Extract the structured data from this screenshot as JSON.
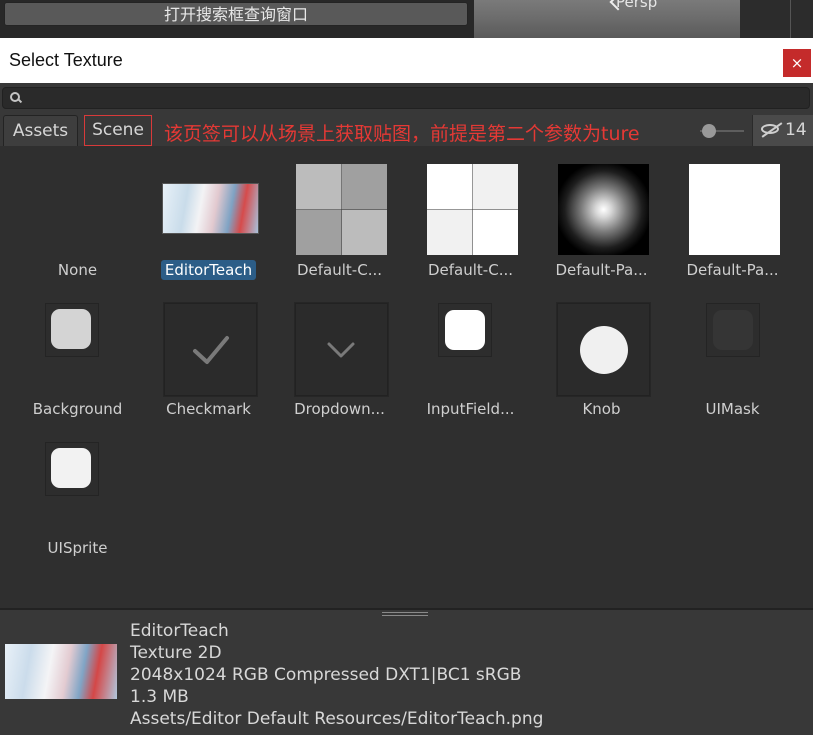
{
  "top": {
    "button_label": "打开搜索框查询窗口",
    "persp_label": "Persp"
  },
  "window": {
    "title": "Select Texture",
    "close_glyph": "×"
  },
  "search": {
    "value": "",
    "placeholder": ""
  },
  "tabs": {
    "assets": "Assets",
    "scene": "Scene",
    "annotation": "该页签可以从场景上获取贴图，前提是第二个参数为ture",
    "hidden_count": "14"
  },
  "items": [
    {
      "label": "None",
      "selected": false
    },
    {
      "label": "EditorTeach",
      "selected": true
    },
    {
      "label": "Default-C...",
      "selected": false
    },
    {
      "label": "Default-C...",
      "selected": false
    },
    {
      "label": "Default-Pa...",
      "selected": false
    },
    {
      "label": "Default-Pa...",
      "selected": false
    },
    {
      "label": "Background",
      "selected": false
    },
    {
      "label": "Checkmark",
      "selected": false
    },
    {
      "label": "Dropdown...",
      "selected": false
    },
    {
      "label": "InputField...",
      "selected": false
    },
    {
      "label": "Knob",
      "selected": false
    },
    {
      "label": "UIMask",
      "selected": false
    },
    {
      "label": "UISprite",
      "selected": false
    }
  ],
  "preview": {
    "name": "EditorTeach",
    "type": "Texture 2D",
    "format": "2048x1024  RGB Compressed DXT1|BC1 sRGB",
    "size": "1.3 MB",
    "path": "Assets/Editor Default Resources/EditorTeach.png"
  },
  "colors": {
    "accent_selection": "#2c5d87",
    "annotation_red": "#e53935",
    "close_red": "#c42b2b"
  },
  "icons": {
    "search": "search-icon",
    "eye": "eye-hidden-icon",
    "close": "close-icon"
  }
}
